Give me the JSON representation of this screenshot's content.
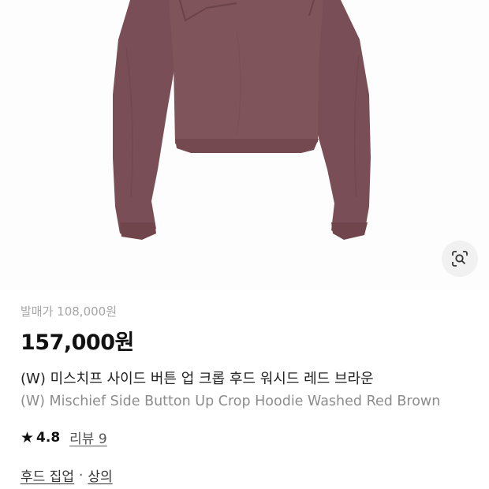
{
  "product": {
    "release_price_label": "발매가 108,000원",
    "price": "157,000원",
    "name_ko": "(W) 미스치프 사이드 버튼 업 크롭 후드 워시드 레드 브라운",
    "name_en": "(W) Mischief Side Button Up Crop Hoodie Washed Red Brown",
    "rating": "4.8",
    "review_link": "리뷰 9",
    "categories": [
      "후드 집업",
      "상의"
    ],
    "category_separator": "·"
  },
  "icons": {
    "rating": "star-icon",
    "image_search": "lens-search-icon"
  },
  "colors": {
    "garment": "#7d5159",
    "price_text": "#111111",
    "muted_text": "#a6a6a6"
  }
}
